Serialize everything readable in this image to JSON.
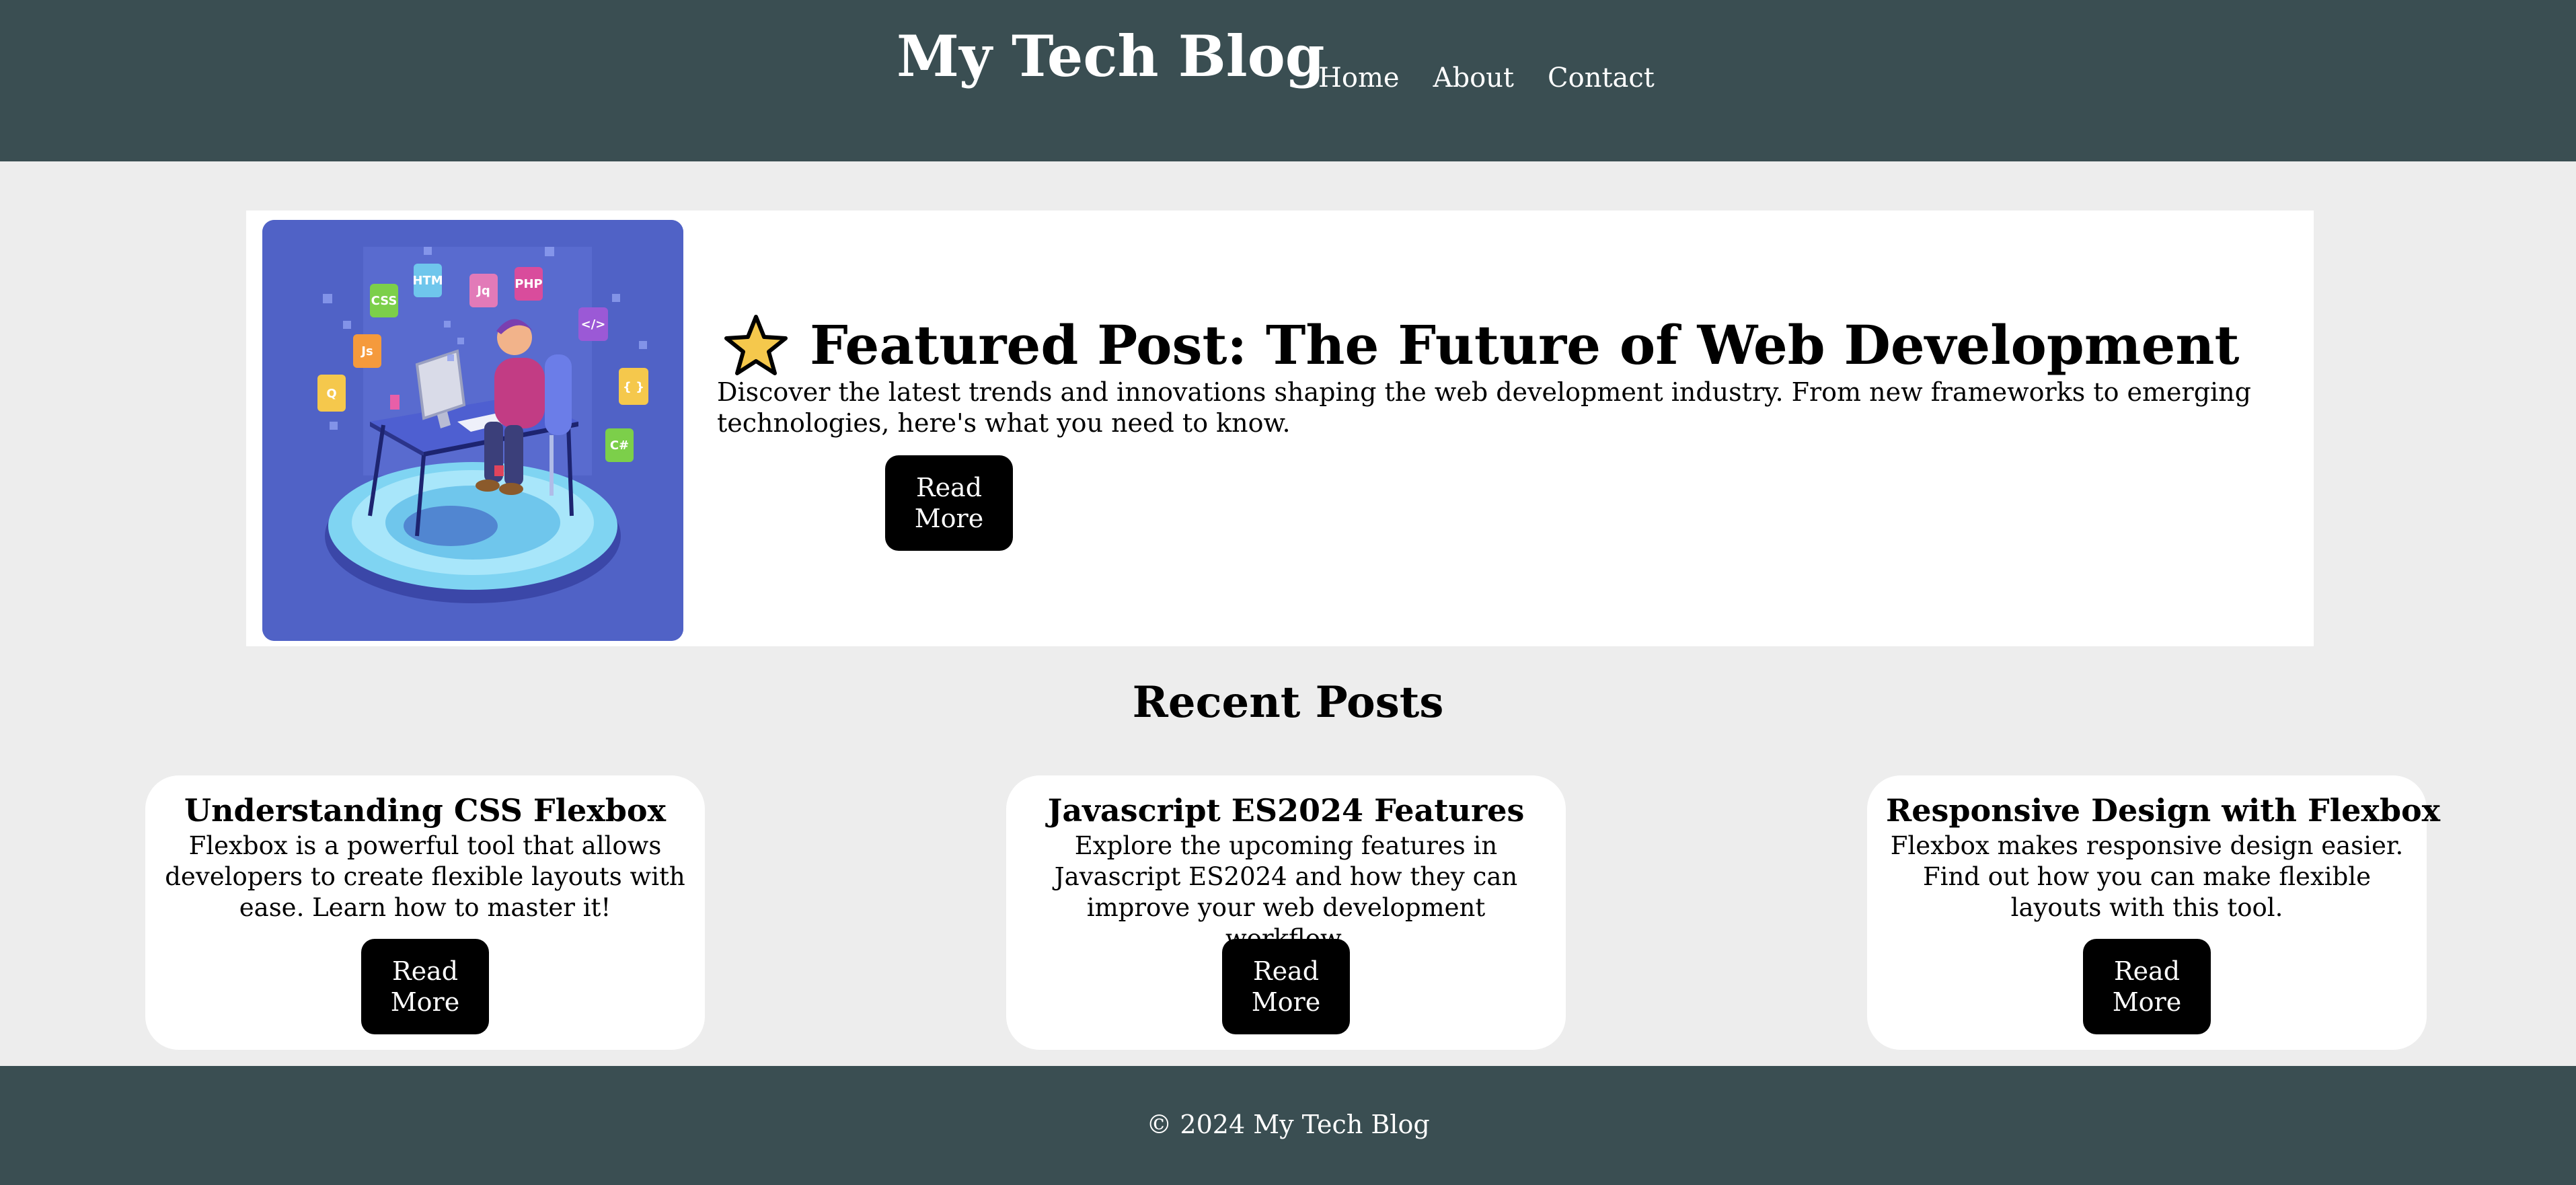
{
  "header": {
    "site_title": "My Tech Blog",
    "nav": [
      "Home",
      "About",
      "Contact"
    ]
  },
  "featured": {
    "image_icon": "developer-illustration",
    "heading_icon": "star-icon",
    "title": "Featured Post: The Future of Web Development",
    "description": "Discover the latest trends and innovations shaping the web development industry. From new frameworks to emerging technologies, here's what you need to know.",
    "button_label": "Read More"
  },
  "recent": {
    "title": "Recent Posts",
    "posts": [
      {
        "title": "Understanding CSS Flexbox",
        "excerpt": "Flexbox is a powerful tool that allows developers to create flexible layouts with ease. Learn how to master it!",
        "button_label": "Read More"
      },
      {
        "title": "Javascript ES2024 Features",
        "excerpt": "Explore the upcoming features in Javascript ES2024 and how they can improve your web development workflow.",
        "button_label": "Read More"
      },
      {
        "title": "Responsive Design with Flexbox",
        "excerpt": "Flexbox makes responsive design easier. Find out how you can make flexible layouts with this tool.",
        "button_label": "Read More"
      }
    ]
  },
  "footer": {
    "copyright": "© 2024 My Tech Blog"
  },
  "colors": {
    "header_bg": "#3a4e52",
    "page_bg": "#ededed",
    "card_bg": "#ffffff",
    "button_bg": "#000000",
    "image_bg": "#5062c6",
    "star": "#f5c84c"
  }
}
